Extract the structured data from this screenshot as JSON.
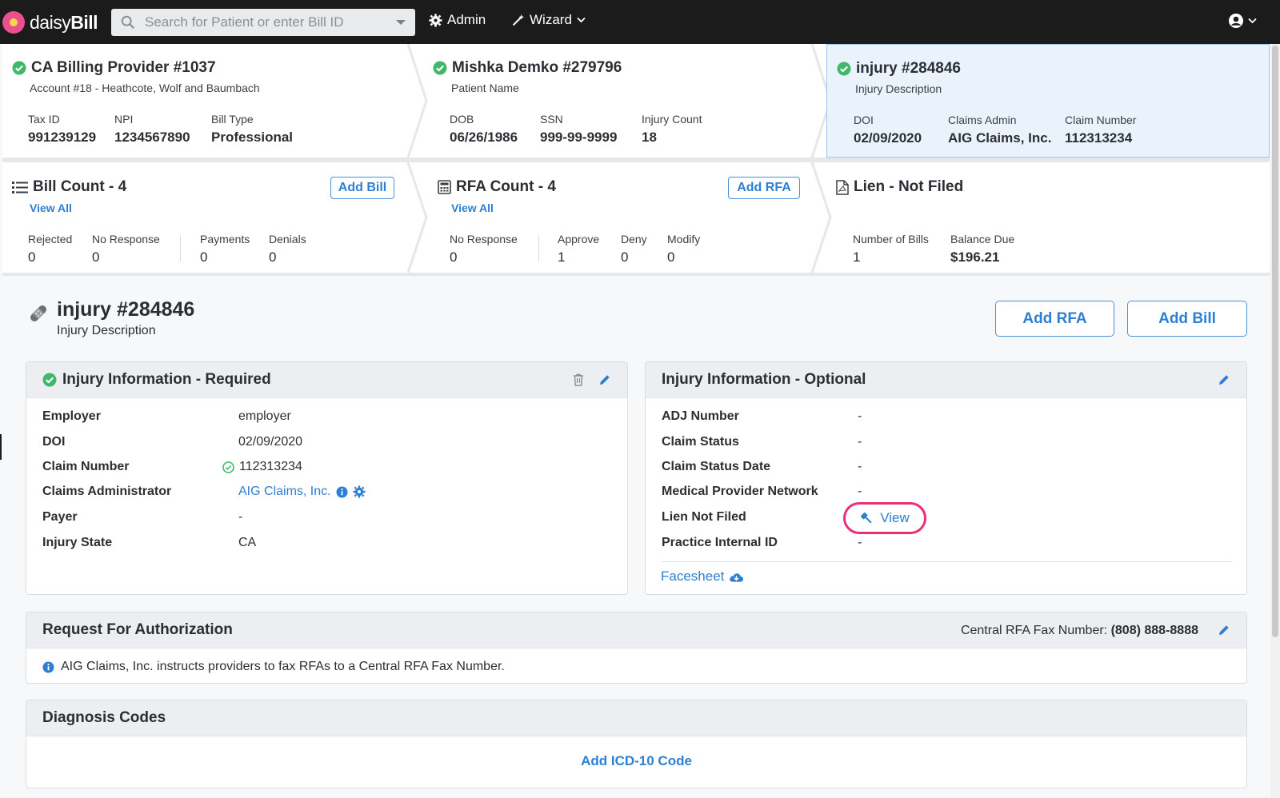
{
  "topbar": {
    "logo_prefix": "daisy",
    "logo_suffix": "Bill",
    "search_placeholder": "Search for Patient or enter Bill ID",
    "admin_label": "Admin",
    "wizard_label": "Wizard"
  },
  "summary": {
    "provider": {
      "title": "CA Billing Provider #1037",
      "subtitle": "Account #18 - Heathcote, Wolf and Baumbach",
      "fields": [
        {
          "label": "Tax ID",
          "value": "991239129"
        },
        {
          "label": "NPI",
          "value": "1234567890"
        },
        {
          "label": "Bill Type",
          "value": "Professional"
        }
      ]
    },
    "patient": {
      "title": "Mishka Demko #279796",
      "subtitle": "Patient Name",
      "fields": [
        {
          "label": "DOB",
          "value": "06/26/1986"
        },
        {
          "label": "SSN",
          "value": "999-99-9999"
        },
        {
          "label": "Injury Count",
          "value": "18"
        }
      ]
    },
    "injury": {
      "title": "injury #284846",
      "subtitle": "Injury Description",
      "fields": [
        {
          "label": "DOI",
          "value": "02/09/2020"
        },
        {
          "label": "Claims Admin",
          "value": "AIG Claims, Inc."
        },
        {
          "label": "Claim Number",
          "value": "112313234"
        }
      ]
    },
    "bills": {
      "title": "Bill Count - 4",
      "view_all": "View All",
      "add_label": "Add Bill",
      "stats": [
        {
          "label": "Rejected",
          "value": "0"
        },
        {
          "label": "No Response",
          "value": "0"
        },
        {
          "label": "Payments",
          "value": "0"
        },
        {
          "label": "Denials",
          "value": "0"
        }
      ]
    },
    "rfa": {
      "title": "RFA Count - 4",
      "view_all": "View All",
      "add_label": "Add RFA",
      "stats": [
        {
          "label": "No Response",
          "value": "0"
        },
        {
          "label": "Approve",
          "value": "1"
        },
        {
          "label": "Deny",
          "value": "0"
        },
        {
          "label": "Modify",
          "value": "0"
        }
      ]
    },
    "lien": {
      "title": "Lien - Not Filed",
      "stats": [
        {
          "label": "Number of Bills",
          "value": "1"
        },
        {
          "label": "Balance Due",
          "value": "$196.21"
        }
      ]
    }
  },
  "page": {
    "title": "injury #284846",
    "subtitle": "Injury Description",
    "add_rfa": "Add RFA",
    "add_bill": "Add Bill"
  },
  "required_panel": {
    "title": "Injury Information - Required",
    "rows": [
      {
        "label": "Employer",
        "value": "employer"
      },
      {
        "label": "DOI",
        "value": "02/09/2020"
      },
      {
        "label": "Claim Number",
        "value": "112313234"
      },
      {
        "label": "Claims Administrator",
        "value": "AIG Claims, Inc."
      },
      {
        "label": "Payer",
        "value": "-"
      },
      {
        "label": "Injury State",
        "value": "CA"
      }
    ]
  },
  "optional_panel": {
    "title": "Injury Information - Optional",
    "rows": [
      {
        "label": "ADJ Number",
        "value": "-"
      },
      {
        "label": "Claim Status",
        "value": "-"
      },
      {
        "label": "Claim Status Date",
        "value": "-"
      },
      {
        "label": "Medical Provider Network",
        "value": "-"
      },
      {
        "label": "Lien Not Filed",
        "value": "View"
      },
      {
        "label": "Practice Internal ID",
        "value": "-"
      }
    ],
    "facesheet": "Facesheet"
  },
  "rfa_panel": {
    "title": "Request For Authorization",
    "fax_label": "Central RFA Fax Number:",
    "fax_number": "(808) 888-8888",
    "note": "AIG Claims, Inc. instructs providers to fax RFAs to a Central RFA Fax Number."
  },
  "diagnosis_panel": {
    "title": "Diagnosis Codes",
    "add_label": "Add ICD-10 Code"
  },
  "colors": {
    "accent": "#2d7fd3",
    "success": "#3fb86b",
    "highlight_ring": "#ea2f78",
    "topbar": "#1b1b1b"
  }
}
